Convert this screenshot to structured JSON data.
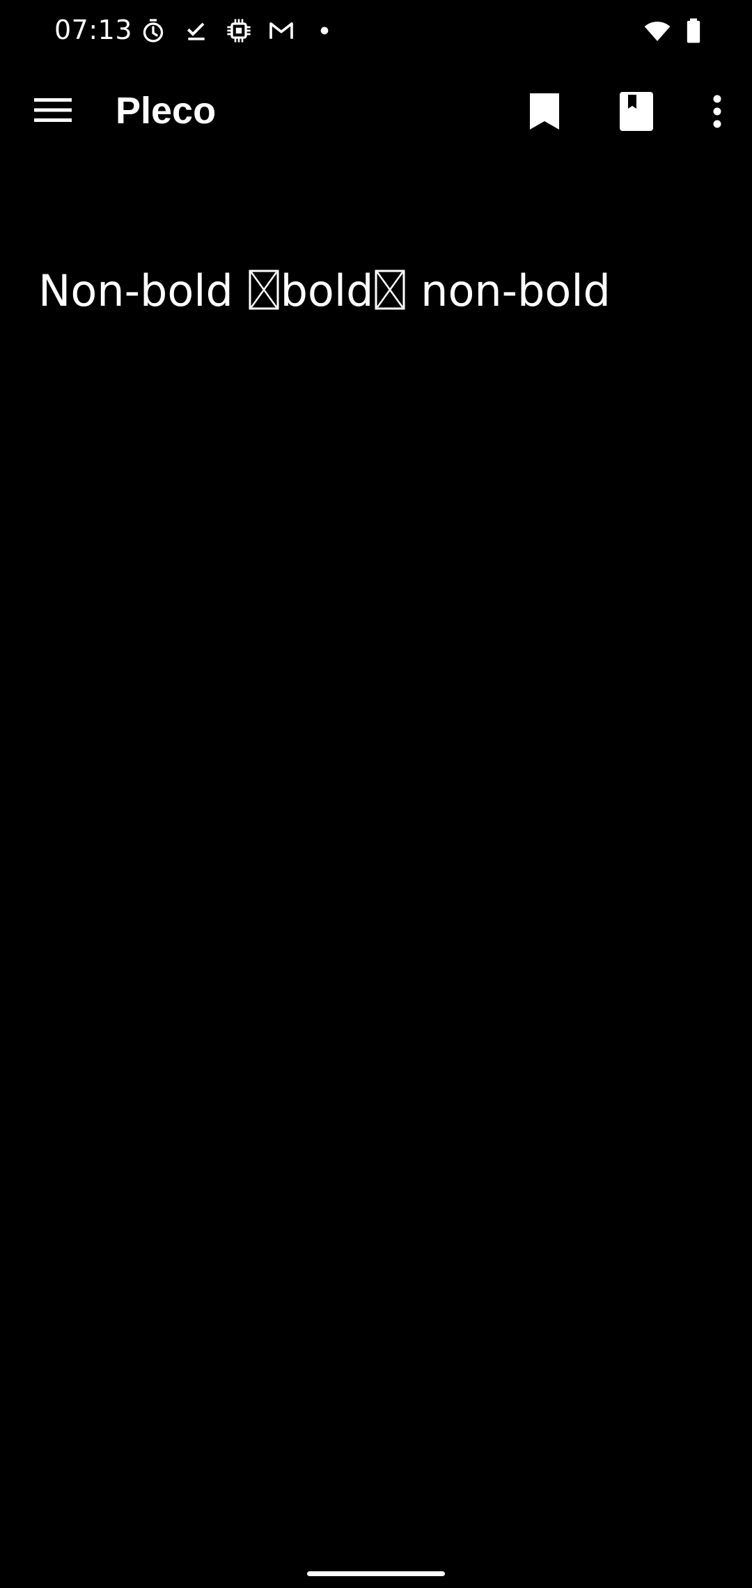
{
  "status_bar": {
    "time": "07:13",
    "notification_icons": [
      "stopwatch-icon",
      "download-done-icon",
      "chip-icon",
      "gmail-icon",
      "dot-icon"
    ],
    "system_icons": [
      "wifi-icon",
      "battery-icon"
    ]
  },
  "app_bar": {
    "title": "Pleco",
    "actions": [
      "bookmark-icon",
      "book-bookmark-icon",
      "more-vert-icon"
    ]
  },
  "content": {
    "segment_1": "Non-bold ",
    "segment_2": "bold",
    "segment_3": " non-bold"
  },
  "colors": {
    "background": "#000000",
    "foreground": "#ffffff"
  }
}
